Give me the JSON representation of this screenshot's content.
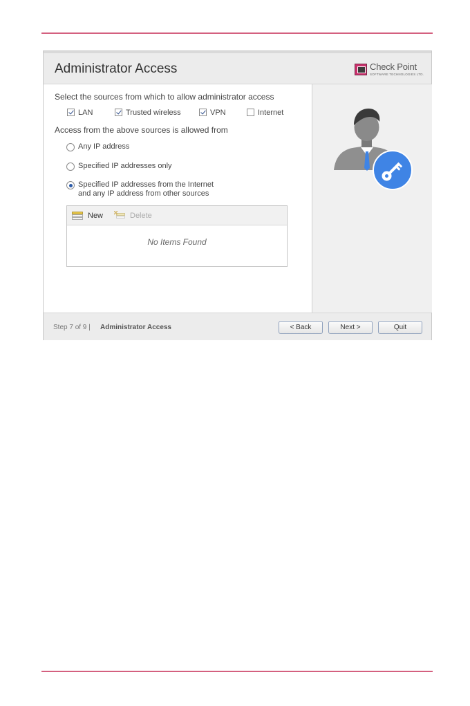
{
  "window": {
    "title": "Administrator Access",
    "logo": {
      "name": "Check Point",
      "tagline": "SOFTWARE TECHNOLOGIES LTD."
    }
  },
  "sources": {
    "heading": "Select the sources from which to allow administrator access",
    "options": [
      {
        "label": "LAN",
        "checked": true
      },
      {
        "label": "Trusted wireless",
        "checked": true
      },
      {
        "label": "VPN",
        "checked": true
      },
      {
        "label": "Internet",
        "checked": false
      }
    ]
  },
  "access": {
    "heading": "Access from the above sources is allowed from",
    "options": [
      {
        "label": "Any IP address",
        "selected": false
      },
      {
        "label": "Specified IP addresses only",
        "selected": false
      },
      {
        "label_line1": "Specified IP addresses from the Internet",
        "label_line2": "and any IP address from other sources",
        "selected": true
      }
    ]
  },
  "grid": {
    "new_label": "New",
    "delete_label": "Delete",
    "empty_text": "No Items Found"
  },
  "side_panel": {
    "icons": [
      "admin-user-icon",
      "key-icon"
    ],
    "accent": "#3f84e5"
  },
  "footer": {
    "step": "Step 7 of 9 |",
    "page": "Administrator Access",
    "back_label": "< Back",
    "next_label": "Next >",
    "quit_label": "Quit"
  },
  "colors": {
    "rule": "#d4607f",
    "radio_selected": "#2b5aa8"
  }
}
